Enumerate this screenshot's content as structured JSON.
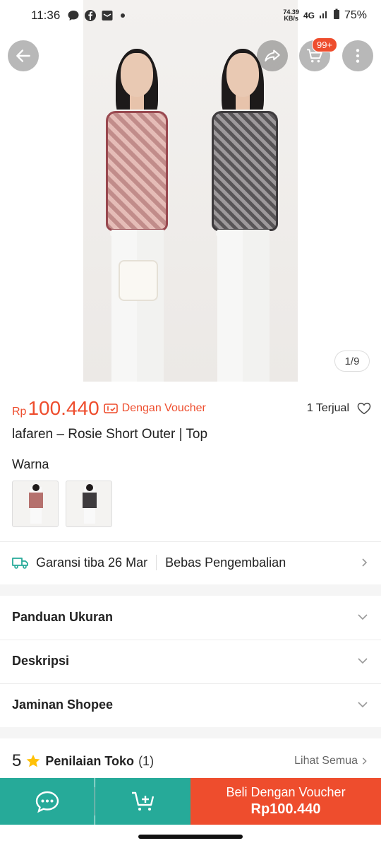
{
  "status_bar": {
    "time": "11:36",
    "speed_value": "74.39",
    "speed_unit": "KB/s",
    "network": "4G",
    "battery": "75%"
  },
  "hero": {
    "cart_badge": "99+",
    "image_counter": "1/9"
  },
  "product": {
    "currency": "Rp",
    "price": "100.440",
    "voucher_label": "Dengan Voucher",
    "sold": "1 Terjual",
    "title": "lafaren – Rosie Short Outer | Top",
    "variant_label": "Warna"
  },
  "shipping": {
    "guarantee": "Garansi tiba 26 Mar",
    "returns": "Bebas Pengembalian"
  },
  "sections": {
    "size_guide": "Panduan Ukuran",
    "description": "Deskripsi",
    "guarantee": "Jaminan Shopee"
  },
  "ratings": {
    "score": "5",
    "label": "Penilaian Toko",
    "count": "(1)",
    "see_all": "Lihat Semua"
  },
  "bottom_bar": {
    "buy_label": "Beli Dengan Voucher",
    "buy_price": "Rp100.440"
  },
  "colors": {
    "brand_orange": "#ee4d2d",
    "chat_teal": "#26aa99"
  }
}
